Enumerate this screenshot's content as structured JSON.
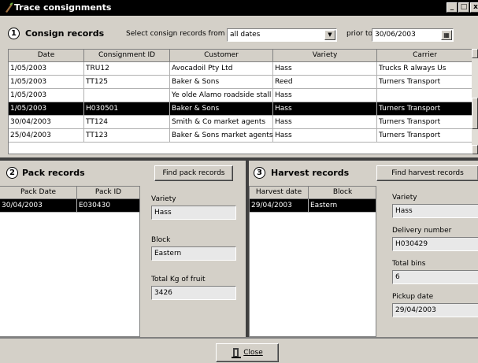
{
  "window": {
    "title": "Trace consignments",
    "min": "_",
    "max": "□",
    "close": "x"
  },
  "consign": {
    "number": "1",
    "title": "Consign records",
    "select_label": "Select consign records from",
    "range_value": "all dates",
    "prior_label": "prior to",
    "prior_date": "30/06/2003",
    "columns": [
      "Date",
      "Consignment ID",
      "Customer",
      "Variety",
      "Carrier"
    ],
    "rows": [
      [
        "1/05/2003",
        "TRU12",
        "Avocadoil Pty Ltd",
        "Hass",
        "Trucks R always Us"
      ],
      [
        "1/05/2003",
        "TT125",
        "Baker & Sons",
        "Reed",
        "Turners Transport"
      ],
      [
        "1/05/2003",
        "",
        "Ye olde Alamo roadside stall",
        "Hass",
        ""
      ],
      [
        "1/05/2003",
        "H030501",
        "Baker & Sons",
        "Hass",
        "Turners Transport"
      ],
      [
        "30/04/2003",
        "TT124",
        "Smith & Co market agents",
        "Hass",
        "Turners Transport"
      ],
      [
        "25/04/2003",
        "TT123",
        "Baker & Sons market agents",
        "Hass",
        "Turners Transport"
      ]
    ],
    "selected_row": 3
  },
  "pack": {
    "number": "2",
    "title": "Pack records",
    "find_button": "Find pack records",
    "columns": [
      "Pack Date",
      "Pack ID"
    ],
    "rows": [
      [
        "30/04/2003",
        "E030430"
      ]
    ],
    "variety_label": "Variety",
    "variety_value": "Hass",
    "block_label": "Block",
    "block_value": "Eastern",
    "kg_label": "Total Kg of fruit",
    "kg_value": "3426"
  },
  "harvest": {
    "number": "3",
    "title": "Harvest records",
    "find_button": "Find harvest records",
    "columns": [
      "Harvest date",
      "Block"
    ],
    "rows": [
      [
        "29/04/2003",
        "Eastern"
      ]
    ],
    "variety_label": "Variety",
    "variety_value": "Hass",
    "delivery_label": "Delivery number",
    "delivery_value": "H030429",
    "bins_label": "Total bins",
    "bins_value": "6",
    "pickup_label": "Pickup date",
    "pickup_value": "29/04/2003"
  },
  "footer": {
    "close_button": "Close"
  }
}
